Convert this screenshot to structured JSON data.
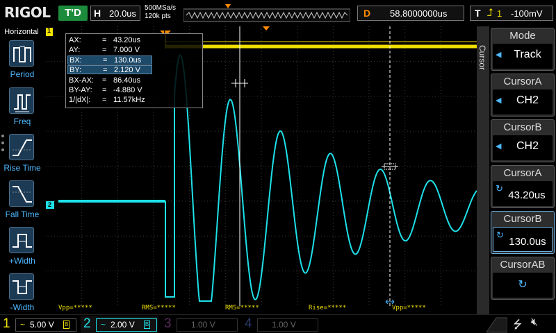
{
  "topbar": {
    "logo": "RIGOL",
    "run_state": "T'D",
    "horiz_label": "H",
    "timebase": "20.0us",
    "sample_rate": "500MSa/s",
    "mem_depth": "120k pts",
    "delay_label": "D",
    "delay_value": "58.8000000us",
    "trig_label": "T",
    "trig_icon": "rising-edge-icon",
    "trig_channel": "1",
    "trig_level": "-100mV"
  },
  "left_panel": {
    "title": "Horizontal",
    "items": [
      {
        "label": "Period",
        "icon": "period-icon"
      },
      {
        "label": "Freq",
        "icon": "frequency-icon"
      },
      {
        "label": "Rise Time",
        "icon": "rise-time-icon"
      },
      {
        "label": "Fall Time",
        "icon": "fall-time-icon"
      },
      {
        "label": "+Width",
        "icon": "positive-width-icon"
      },
      {
        "label": "-Width",
        "icon": "negative-width-icon"
      }
    ]
  },
  "cursor_readout": {
    "rows": [
      {
        "key": "AX:",
        "eq": "=",
        "val": "43.20us"
      },
      {
        "key": "AY:",
        "eq": "=",
        "val": "7.000 V"
      },
      {
        "key": "BX:",
        "eq": "=",
        "val": "130.0us"
      },
      {
        "key": "BY:",
        "eq": "=",
        "val": "2.120 V"
      },
      {
        "key": "BX-AX:",
        "eq": "=",
        "val": "86.40us"
      },
      {
        "key": "BY-AY:",
        "eq": "=",
        "val": "-4.880 V"
      },
      {
        "key": "1/|dX|:",
        "eq": "=",
        "val": "11.57kHz"
      }
    ]
  },
  "plot_labels": {
    "ch2_marker": "2",
    "ch1_marker": "1",
    "trig_pos_marker": "T",
    "meas_tags": [
      "Vpp=*****",
      "RMS=*****",
      "RMS=*****",
      "Rise=*****",
      "Vpp=*****"
    ]
  },
  "right_panel": {
    "side_label": "Cursor",
    "buttons": [
      {
        "title": "Mode",
        "value": "Track",
        "ctrl": "left-arrow-icon"
      },
      {
        "title": "CursorA",
        "value": "CH2",
        "ctrl": "left-arrow-icon"
      },
      {
        "title": "CursorB",
        "value": "CH2",
        "ctrl": "left-arrow-icon"
      },
      {
        "title": "CursorA",
        "value": "43.20us",
        "ctrl": "multipurpose-knob-icon"
      },
      {
        "title": "CursorB",
        "value": "130.0us",
        "ctrl": "multipurpose-knob-icon"
      },
      {
        "title": "CursorAB",
        "value": "",
        "ctrl": "multipurpose-knob-icon"
      }
    ]
  },
  "bottombar": {
    "channels": [
      {
        "num": "1",
        "coupling": "~",
        "scale": "5.00 V",
        "color": "#f0e000",
        "active": true
      },
      {
        "num": "2",
        "coupling": "~",
        "scale": "2.00 V",
        "color": "#1ee0e8",
        "active": true
      },
      {
        "num": "3",
        "coupling": "",
        "scale": "1.00 V",
        "color": "#c040c0",
        "active": false
      },
      {
        "num": "4",
        "coupling": "",
        "scale": "1.00 V",
        "color": "#3a6ac8",
        "active": false
      }
    ],
    "usb_icon": "usb-icon",
    "sound_icon": "speaker-muted-icon"
  },
  "colors": {
    "ch1": "#f0e000",
    "ch2": "#1ee0e8",
    "accent_blue": "#4db8ff",
    "trigger_orange": "#ff8c00"
  }
}
